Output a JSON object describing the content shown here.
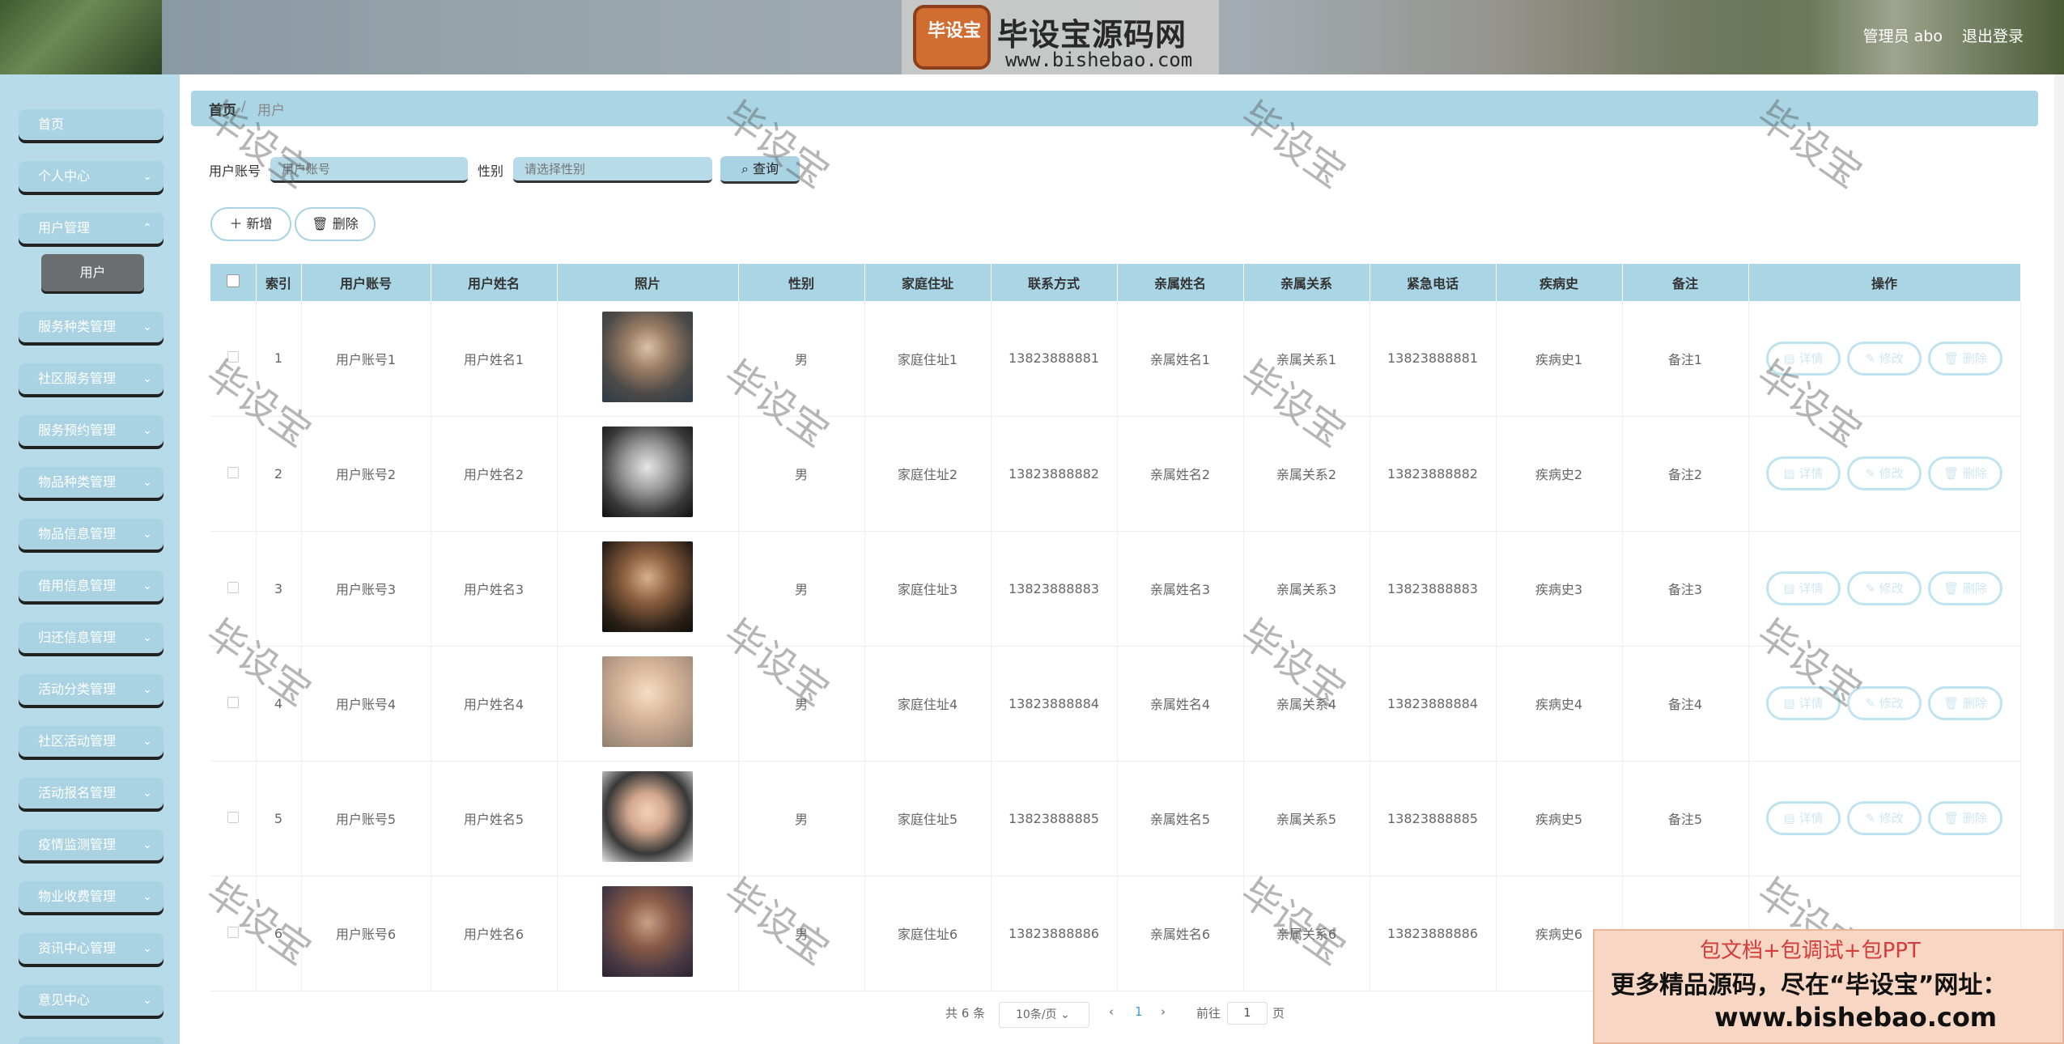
{
  "header": {
    "logo_badge": "毕设宝",
    "logo_title": "毕设宝源码网",
    "logo_url": "www.bishebao.com",
    "user_label": "管理员 abo",
    "logout": "退出登录"
  },
  "sidebar": {
    "items": [
      {
        "label": "首页"
      },
      {
        "label": "个人中心"
      },
      {
        "label": "用户管理"
      },
      {
        "label": "服务种类管理"
      },
      {
        "label": "社区服务管理"
      },
      {
        "label": "服务预约管理"
      },
      {
        "label": "物品种类管理"
      },
      {
        "label": "物品信息管理"
      },
      {
        "label": "借用信息管理"
      },
      {
        "label": "归还信息管理"
      },
      {
        "label": "活动分类管理"
      },
      {
        "label": "社区活动管理"
      },
      {
        "label": "活动报名管理"
      },
      {
        "label": "疫情监测管理"
      },
      {
        "label": "物业收费管理"
      },
      {
        "label": "资讯中心管理"
      },
      {
        "label": "意见中心"
      }
    ],
    "sub_item": "用户"
  },
  "breadcrumb": {
    "home": "首页",
    "sep": "/",
    "current": "用户"
  },
  "search": {
    "account_label": "用户账号",
    "account_placeholder": "用户账号",
    "gender_label": "性别",
    "gender_placeholder": "请选择性别",
    "query_button": "查询"
  },
  "toolbar": {
    "add": "新增",
    "delete": "删除"
  },
  "table": {
    "headers": [
      "索引",
      "用户账号",
      "用户姓名",
      "照片",
      "性别",
      "家庭住址",
      "联系方式",
      "亲属姓名",
      "亲属关系",
      "紧急电话",
      "疾病史",
      "备注",
      "操作"
    ],
    "rows": [
      {
        "index": "1",
        "account": "用户账号1",
        "name": "用户姓名1",
        "gender": "男",
        "address": "家庭住址1",
        "phone": "13823888881",
        "relative": "亲属姓名1",
        "relation": "亲属关系1",
        "emergency": "13823888881",
        "disease": "疾病史1",
        "note": "备注1"
      },
      {
        "index": "2",
        "account": "用户账号2",
        "name": "用户姓名2",
        "gender": "男",
        "address": "家庭住址2",
        "phone": "13823888882",
        "relative": "亲属姓名2",
        "relation": "亲属关系2",
        "emergency": "13823888882",
        "disease": "疾病史2",
        "note": "备注2"
      },
      {
        "index": "3",
        "account": "用户账号3",
        "name": "用户姓名3",
        "gender": "男",
        "address": "家庭住址3",
        "phone": "13823888883",
        "relative": "亲属姓名3",
        "relation": "亲属关系3",
        "emergency": "13823888883",
        "disease": "疾病史3",
        "note": "备注3"
      },
      {
        "index": "4",
        "account": "用户账号4",
        "name": "用户姓名4",
        "gender": "男",
        "address": "家庭住址4",
        "phone": "13823888884",
        "relative": "亲属姓名4",
        "relation": "亲属关系4",
        "emergency": "13823888884",
        "disease": "疾病史4",
        "note": "备注4"
      },
      {
        "index": "5",
        "account": "用户账号5",
        "name": "用户姓名5",
        "gender": "男",
        "address": "家庭住址5",
        "phone": "13823888885",
        "relative": "亲属姓名5",
        "relation": "亲属关系5",
        "emergency": "13823888885",
        "disease": "疾病史5",
        "note": "备注5"
      },
      {
        "index": "6",
        "account": "用户账号6",
        "name": "用户姓名6",
        "gender": "男",
        "address": "家庭住址6",
        "phone": "13823888886",
        "relative": "亲属姓名6",
        "relation": "亲属关系6",
        "emergency": "13823888886",
        "disease": "疾病史6",
        "note": ""
      }
    ],
    "actions": {
      "detail": "详情",
      "edit": "修改",
      "delete": "删除"
    }
  },
  "pagination": {
    "total": "共 6 条",
    "page_size": "10条/页",
    "current": "1",
    "goto": "前往",
    "goto_value": "1",
    "page_unit": "页"
  },
  "watermark": "毕设宝",
  "promo": {
    "line1": "包文档+包调试+包PPT",
    "line2": "更多精品源码，尽在“毕设宝”网址：",
    "line3": "www.bishebao.com"
  },
  "colors": {
    "accent": "#aad5e4",
    "sidebar": "#b7dbe8",
    "action_border": "#bfe3ef"
  }
}
